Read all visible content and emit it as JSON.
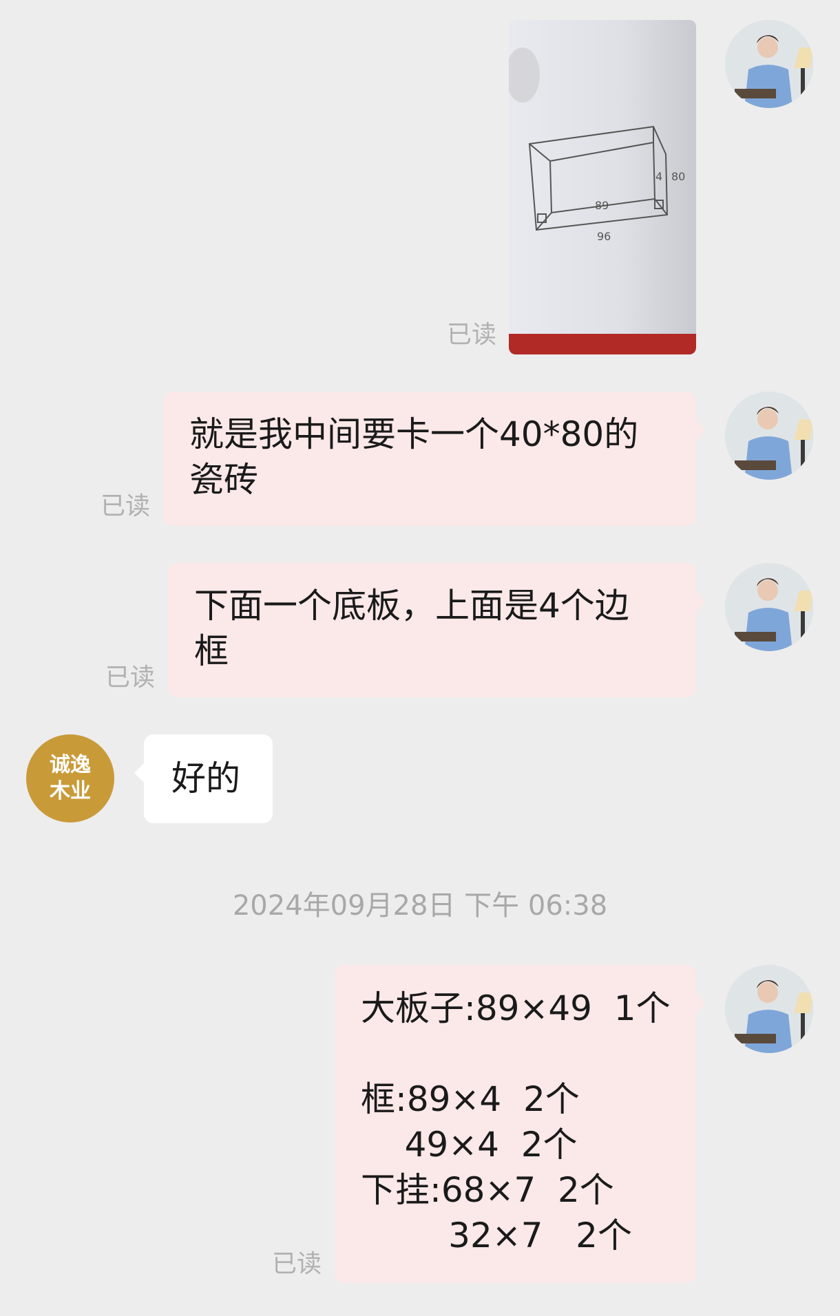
{
  "messages": [
    {
      "type": "image",
      "read_status": "已读"
    },
    {
      "type": "text",
      "text": "就是我中间要卡一个40*80的\n瓷砖",
      "read_status": "已读"
    },
    {
      "type": "text",
      "text": "下面一个底板，上面是4个边\n框",
      "read_status": "已读"
    },
    {
      "type": "text",
      "sender": "诚逸木业",
      "sender_avatar_lines": [
        "诚逸",
        "木业"
      ],
      "text": "好的"
    },
    {
      "type": "timestamp",
      "text": "2024年09月28日 下午 06:38"
    },
    {
      "type": "text",
      "text": "大板子:89×49  1个\n\n框:89×4  2个\n    49×4  2个\n下挂:68×7  2个\n        32×7   2个",
      "read_status": "已读"
    }
  ],
  "sketch_labels": [
    "89",
    "96",
    "4",
    "80"
  ]
}
